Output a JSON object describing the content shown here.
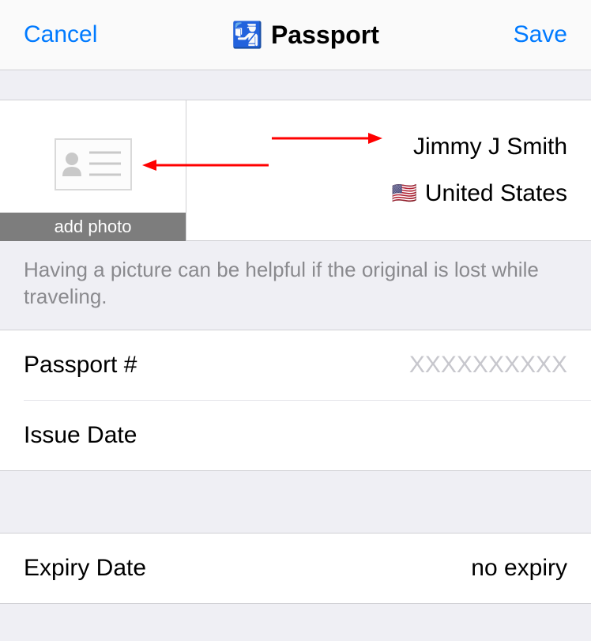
{
  "header": {
    "cancel": "Cancel",
    "title": "Passport",
    "icon": "🛂",
    "save": "Save"
  },
  "photo": {
    "add_label": "add photo"
  },
  "identity": {
    "name": "Jimmy J Smith",
    "country": "United States",
    "flag": "🇺🇸"
  },
  "helper": "Having a picture can be helpful if the original is lost while traveling.",
  "fields": {
    "passport_number": {
      "label": "Passport #",
      "placeholder": "XXXXXXXXXX"
    },
    "issue_date": {
      "label": "Issue Date",
      "value": ""
    },
    "expiry_date": {
      "label": "Expiry Date",
      "value": "no expiry"
    }
  }
}
